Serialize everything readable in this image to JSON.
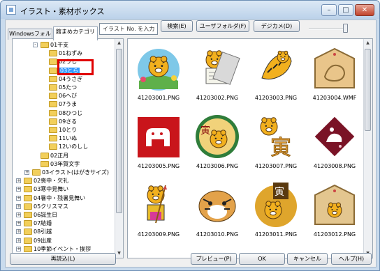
{
  "window": {
    "title": "イラスト・素材ボックス",
    "btn_min": "–",
    "btn_max": "□",
    "btn_close": "✕"
  },
  "tabs": [
    "Windowsフォルダ",
    "館まめカテゴリ"
  ],
  "search": {
    "value": "イラスト No. を入力"
  },
  "toolbar": {
    "search_btn": "検索(E)",
    "userfolder_btn": "ユーザフォルダ(F)",
    "digicam_btn": "デジカメ(D)"
  },
  "tree": [
    {
      "label": "01干支",
      "indent": 2,
      "expander": "-",
      "folder": true
    },
    {
      "label": "01ねずみ",
      "indent": 3,
      "folder": true
    },
    {
      "label": "02うし",
      "indent": 3,
      "folder": true
    },
    {
      "label": "03とら",
      "indent": 3,
      "folder": true,
      "selected": true
    },
    {
      "label": "04うさぎ",
      "indent": 3,
      "folder": true
    },
    {
      "label": "05たつ",
      "indent": 3,
      "folder": true
    },
    {
      "label": "06へび",
      "indent": 3,
      "folder": true
    },
    {
      "label": "07うま",
      "indent": 3,
      "folder": true
    },
    {
      "label": "08ひつじ",
      "indent": 3,
      "folder": true
    },
    {
      "label": "09さる",
      "indent": 3,
      "folder": true
    },
    {
      "label": "10とり",
      "indent": 3,
      "folder": true
    },
    {
      "label": "11いぬ",
      "indent": 3,
      "folder": true
    },
    {
      "label": "12いのしし",
      "indent": 3,
      "folder": true
    },
    {
      "label": "02正月",
      "indent": 2,
      "folder": true
    },
    {
      "label": "03年賀文字",
      "indent": 2,
      "folder": true
    },
    {
      "label": "03イラスト(はがきサイズ)",
      "indent": 1,
      "expander": "+",
      "folder": true
    },
    {
      "label": "02喪中・欠礼",
      "indent": 0,
      "expander": "+",
      "folder": true
    },
    {
      "label": "03寒中見舞い",
      "indent": 0,
      "expander": "+",
      "folder": true
    },
    {
      "label": "04暑中・残暑見舞い",
      "indent": 0,
      "expander": "+",
      "folder": true
    },
    {
      "label": "05クリスマス",
      "indent": 0,
      "expander": "+",
      "folder": true
    },
    {
      "label": "06誕生日",
      "indent": 0,
      "expander": "+",
      "folder": true
    },
    {
      "label": "07結婚",
      "indent": 0,
      "expander": "+",
      "folder": true
    },
    {
      "label": "08引越",
      "indent": 0,
      "expander": "+",
      "folder": true
    },
    {
      "label": "09出産",
      "indent": 0,
      "expander": "+",
      "folder": true
    },
    {
      "label": "10季節イベント・挨拶",
      "indent": 0,
      "expander": "+",
      "folder": true
    }
  ],
  "thumbnails": [
    {
      "file": "41203001.PNG",
      "icon": "tiger-on-hill-icon"
    },
    {
      "file": "41203002.PNG",
      "icon": "tiger-reading-scroll-icon"
    },
    {
      "file": "41203003.PNG",
      "icon": "leaping-tiger-icon"
    },
    {
      "file": "41203004.WMF",
      "icon": "ema-plaque-tiger-icon"
    },
    {
      "file": "41203005.PNG",
      "icon": "red-tiger-stamp-icon"
    },
    {
      "file": "41203006.PNG",
      "icon": "tiger-kanji-circle-icon"
    },
    {
      "file": "41203007.PNG",
      "icon": "cartoon-tiger-kanji-icon"
    },
    {
      "file": "41203008.PNG",
      "icon": "diamond-tiger-icon"
    },
    {
      "file": "41203009.PNG",
      "icon": "tiger-with-arrow-icon"
    },
    {
      "file": "41203010.PNG",
      "icon": "tiger-face-icon"
    },
    {
      "file": "41203011.PNG",
      "icon": "tiger-kanji-banner-icon"
    },
    {
      "file": "41203012.PNG",
      "icon": "ema-tiger-icon"
    }
  ],
  "bottom": {
    "reload": "再読込(L)",
    "preview": "プレビュー(P)",
    "ok": "OK",
    "cancel": "キャンセル",
    "help": "ヘルプ(H)"
  },
  "colors": {
    "selection": "#3399ff",
    "highlight_box": "#e00000",
    "folder": "#f2cf5b"
  }
}
